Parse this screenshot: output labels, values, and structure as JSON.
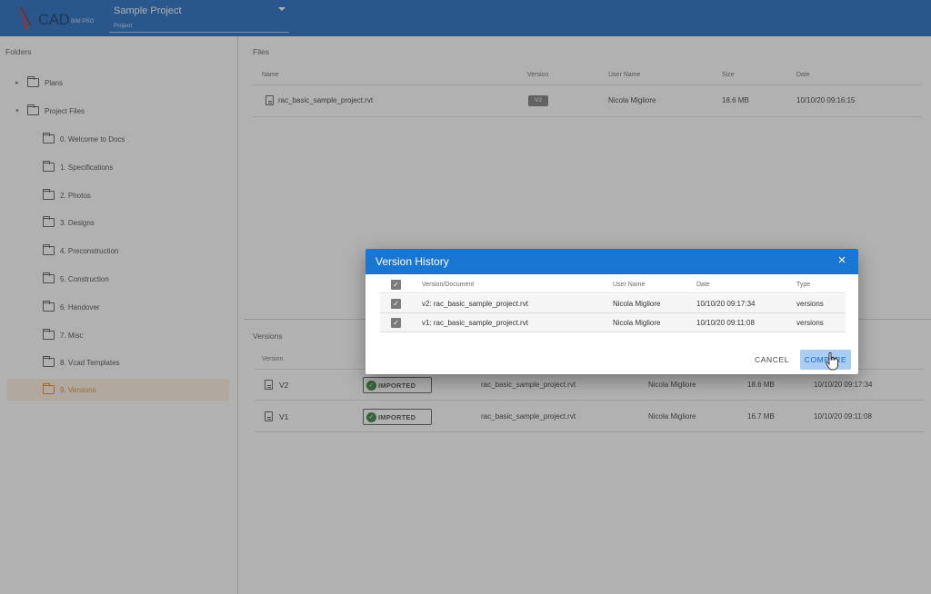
{
  "app": {
    "logo_text": "CAD",
    "logo_sub": "BIM PRO",
    "project_select": {
      "value": "Sample Project",
      "label": "Project"
    }
  },
  "folders": {
    "title": "Folders",
    "items": [
      {
        "label": "Plans",
        "expander": "▸"
      },
      {
        "label": "Project Files",
        "expander": "▾"
      },
      {
        "label": "0. Welcome to Docs"
      },
      {
        "label": "1. Specifications"
      },
      {
        "label": "2. Photos"
      },
      {
        "label": "3. Designs"
      },
      {
        "label": "4. Preconstruction"
      },
      {
        "label": "5. Construction"
      },
      {
        "label": "6. Handover"
      },
      {
        "label": "7. Misc"
      },
      {
        "label": "8. Vcad Templates"
      },
      {
        "label": "9. Versions"
      }
    ]
  },
  "files": {
    "title": "Files",
    "columns": {
      "name": "Name",
      "version": "Version",
      "user": "User Name",
      "size": "Size",
      "date": "Date"
    },
    "rows": [
      {
        "name": "rac_basic_sample_project.rvt",
        "version": "V2",
        "user": "Nicola Migliore",
        "size": "18.6 MB",
        "date": "10/10/20 09:16:15"
      }
    ]
  },
  "versions": {
    "title": "Versions",
    "columns": {
      "version": "Version"
    },
    "rows": [
      {
        "version": "V2",
        "status": "IMPORTED",
        "name": "rac_basic_sample_project.rvt",
        "user": "Nicola Migliore",
        "size": "18.6 MB",
        "date": "10/10/20 09:17:34"
      },
      {
        "version": "V1",
        "status": "IMPORTED",
        "name": "rac_basic_sample_project.rvt",
        "user": "Nicola Migliore",
        "size": "16.7 MB",
        "date": "10/10/20 09:11:08"
      }
    ]
  },
  "dialog": {
    "title": "Version History",
    "close_icon": "×",
    "columns": {
      "doc": "Version/Document",
      "user": "User Name",
      "date": "Date",
      "type": "Type"
    },
    "rows": [
      {
        "doc": "v2: rac_basic_sample_project.rvt",
        "user": "Nicola Migliore",
        "date": "10/10/20 09:17:34",
        "type": "versions",
        "checked": true
      },
      {
        "doc": "v1: rac_basic_sample_project.rvt",
        "user": "Nicola Migliore",
        "date": "10/10/20 09:11:08",
        "type": "versions",
        "checked": true
      }
    ],
    "cancel_label": "CANCEL",
    "compare_label": "COMPARE"
  },
  "colors": {
    "topbar": "#1565c0",
    "dialog_header": "#1976d2",
    "selected_folder": "#e08a1a",
    "imported_green": "#2e7d32"
  }
}
